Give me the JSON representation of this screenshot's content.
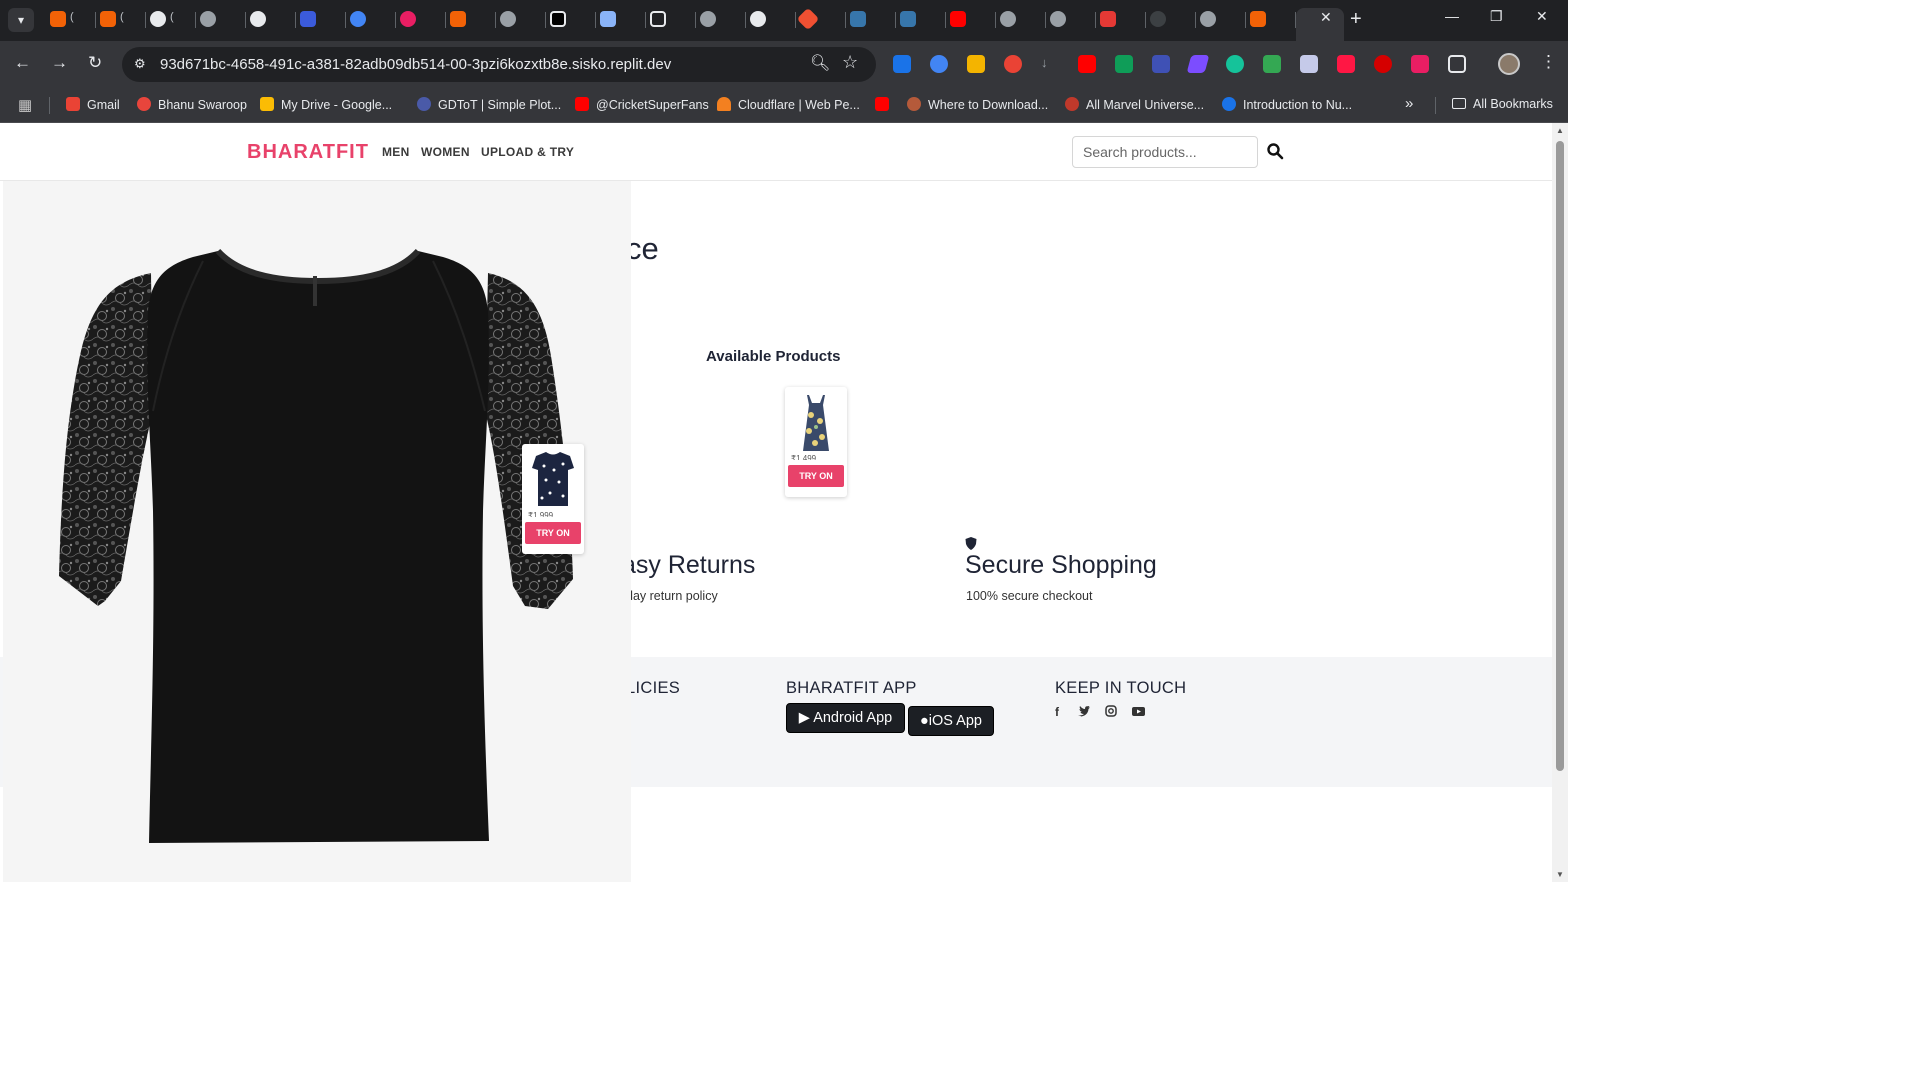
{
  "browser": {
    "address_url": "93d671bc-4658-491c-a381-82adb09db514-00-3pzi6kozxtb8e.sisko.replit.dev",
    "bookmarks": [
      {
        "label": "Gmail",
        "color": "#ea4335"
      },
      {
        "label": "Bhanu Swaroop",
        "color": "#e8453c"
      },
      {
        "label": "My Drive - Google...",
        "color": "#fbbc04"
      },
      {
        "label": "GDToT | Simple Plot...",
        "color": "#4a5aa8"
      },
      {
        "label": "@CricketSuperFans",
        "color": "#ff0000"
      },
      {
        "label": "Cloudflare | Web Pe...",
        "color": "#f38020"
      },
      {
        "label": "",
        "color": "#ff0000"
      },
      {
        "label": "Where to Download...",
        "color": "#b55a3a"
      },
      {
        "label": "All Marvel Universe...",
        "color": "#c0392b"
      },
      {
        "label": "Introduction to Nu...",
        "color": "#1a73e8"
      }
    ],
    "all_bookmarks_label": "All Bookmarks"
  },
  "site": {
    "brand": "BHARATFIT",
    "nav": [
      "MEN",
      "WOMEN",
      "UPLOAD & TRY"
    ],
    "search_placeholder": "Search products...",
    "hero_title_fragment": "ce",
    "available_products_title": "Available Products",
    "products": [
      {
        "price": "₹1,999",
        "try_on_label": "TRY ON",
        "image": "polka-dot-top"
      },
      {
        "price": "₹1,499",
        "try_on_label": "TRY ON",
        "image": "floral-dress"
      }
    ],
    "features": [
      {
        "title": "asy Returns",
        "desc": "day return policy"
      },
      {
        "title": "Secure Shopping",
        "desc": "100% secure checkout",
        "icon": "shield-icon"
      }
    ],
    "footer": {
      "policies_heading": "LICIES",
      "app_heading": "BHARATFIT APP",
      "android_label": "Android App",
      "ios_label": "iOS App",
      "keep_in_touch_heading": "KEEP IN TOUCH",
      "social_icons": [
        "facebook-icon",
        "twitter-icon",
        "instagram-icon",
        "youtube-icon"
      ]
    },
    "overlay_image": "black-lace-sleeve-top"
  },
  "colors": {
    "accent": "#e8426a",
    "text_dark": "#1f2435",
    "footer_bg": "#f4f5f7"
  }
}
